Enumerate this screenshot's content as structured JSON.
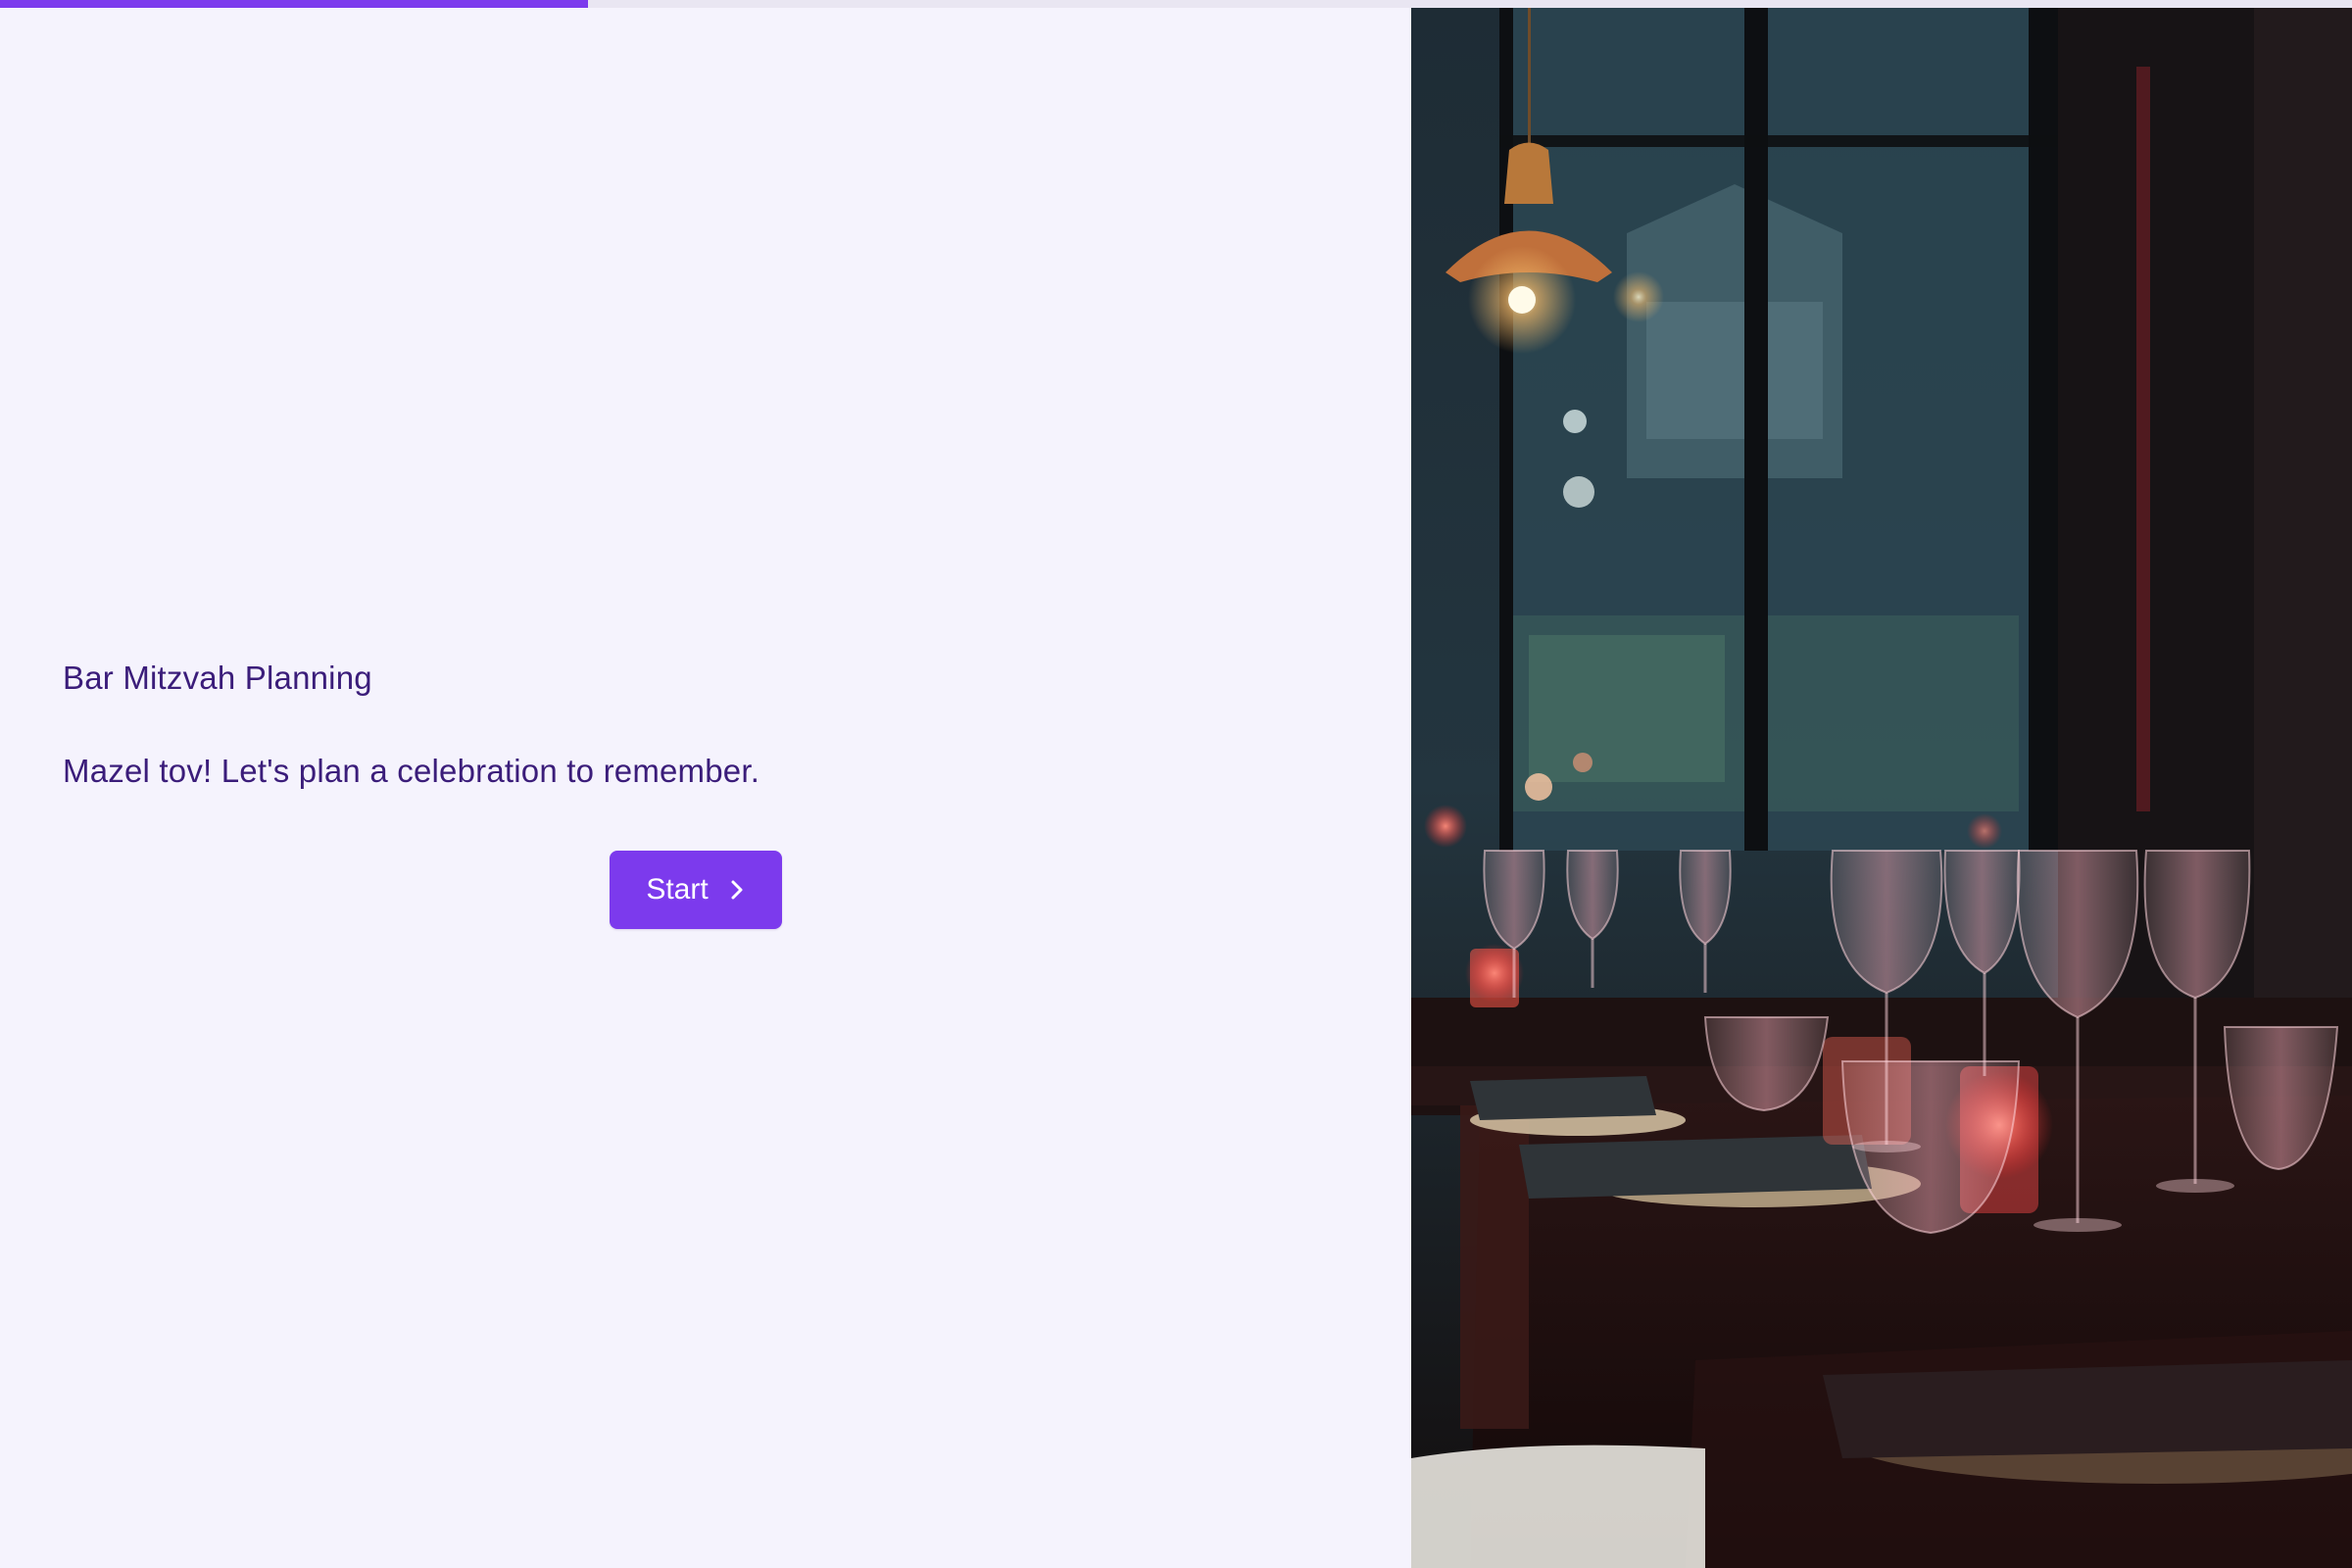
{
  "progress": {
    "fraction": 0.25,
    "color": "#7c3aed"
  },
  "form": {
    "title": "Bar Mitzvah Planning",
    "subtitle": "Mazel tov! Let's plan a celebration to remember.",
    "start_label": "Start",
    "start_icon": "chevron-right-icon",
    "accent_color": "#7c3aed"
  },
  "hero": {
    "description_icon": "restaurant-table-photo"
  }
}
